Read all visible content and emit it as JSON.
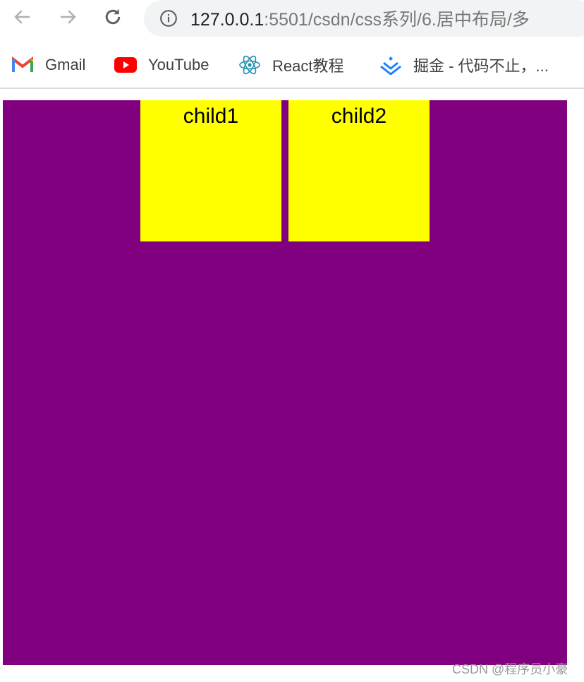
{
  "browser": {
    "url_host": "127.0.0.1",
    "url_rest": ":5501/csdn/css系列/6.居中布局/多",
    "icons": {
      "back": "arrow-left-icon",
      "forward": "arrow-right-icon",
      "reload": "reload-icon",
      "info": "info-icon"
    }
  },
  "bookmarks": [
    {
      "label": "Gmail",
      "icon": "gmail-icon"
    },
    {
      "label": "YouTube",
      "icon": "youtube-icon"
    },
    {
      "label": "React教程",
      "icon": "react-icon"
    },
    {
      "label": "掘金 - 代码不止，...",
      "icon": "juejin-icon"
    }
  ],
  "page": {
    "parent_color": "#800080",
    "child_color": "#ffff00",
    "children": [
      {
        "label": "child1"
      },
      {
        "label": "child2"
      }
    ]
  },
  "watermark": "CSDN @程序员小豪"
}
